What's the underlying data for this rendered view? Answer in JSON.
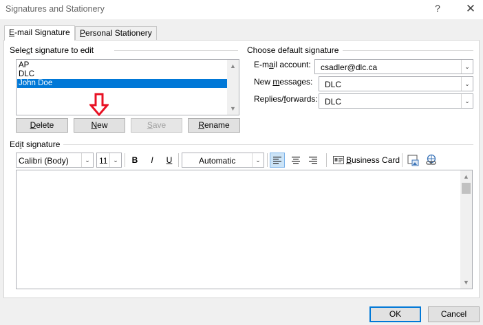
{
  "window": {
    "title": "Signatures and Stationery",
    "help_glyph": "?",
    "close_glyph": "✕"
  },
  "tabs": [
    {
      "pre": "",
      "ul": "E",
      "post": "-mail Signature",
      "active": true
    },
    {
      "pre": "",
      "ul": "P",
      "post": "ersonal Stationery",
      "active": false
    }
  ],
  "select_signature": {
    "label_pre": "Sele",
    "label_ul": "c",
    "label_post": "t signature to edit",
    "items": [
      {
        "label": "AP",
        "selected": false
      },
      {
        "label": "DLC",
        "selected": false
      },
      {
        "label": "John Doe",
        "selected": true
      }
    ],
    "buttons": {
      "delete": {
        "ul": "D",
        "post": "elete"
      },
      "new": {
        "ul": "N",
        "post": "ew"
      },
      "save": {
        "ul": "S",
        "post": "ave"
      },
      "rename": {
        "ul": "R",
        "post": "ename"
      }
    }
  },
  "default_signature": {
    "label": "Choose default signature",
    "email_account": {
      "pre": "E-m",
      "ul": "a",
      "post": "il account:",
      "value": "csadler@dlc.ca"
    },
    "new_messages": {
      "pre": "New ",
      "ul": "m",
      "post": "essages:",
      "value": "DLC"
    },
    "replies_forwards": {
      "pre": "Replies/",
      "ul": "f",
      "post": "orwards:",
      "value": "DLC"
    }
  },
  "edit_signature": {
    "label_pre": "Ed",
    "label_ul": "i",
    "label_post": "t signature",
    "font_family": "Calibri (Body)",
    "font_size": "11",
    "bold_glyph": "B",
    "italic_glyph": "I",
    "underline_glyph": "U",
    "font_color": "Automatic",
    "business_card": {
      "ul": "B",
      "post": "usiness Card"
    }
  },
  "footer": {
    "ok": "OK",
    "cancel": "Cancel"
  },
  "colors": {
    "accent": "#0078d7",
    "arrow": "#e81123"
  }
}
